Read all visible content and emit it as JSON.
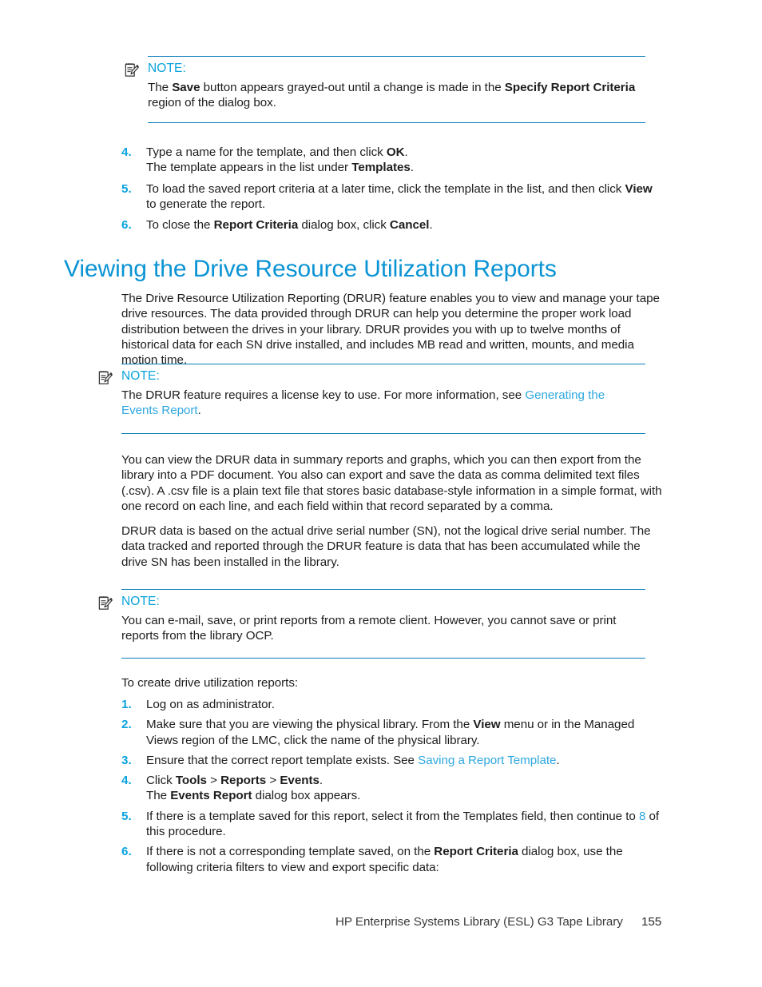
{
  "page": {
    "number": "155",
    "footer_title": "HP Enterprise Systems Library (ESL) G3 Tape Library"
  },
  "colors": {
    "heading_blue": "#0b94d4",
    "note_label_blue": "#0aa3dd",
    "rule_blue": "#0b7fb8",
    "link_blue": "#2fa8e0",
    "body_text": "#1d1d1d"
  },
  "note_1": {
    "icon": "note-pad-pencil-icon",
    "label": "NOTE:",
    "text_parts": [
      {
        "t": "The ",
        "b": false
      },
      {
        "t": "Save",
        "b": true
      },
      {
        "t": " button appears grayed-out until a change is made in the ",
        "b": false
      },
      {
        "t": "Specify Report Criteria",
        "b": true
      },
      {
        "t": " region of the dialog box.",
        "b": false
      }
    ]
  },
  "steps_top": {
    "items": [
      {
        "marker": "4.",
        "lines": [
          [
            {
              "t": "Type a name for the template, and then click ",
              "b": false
            },
            {
              "t": "OK",
              "b": true
            },
            {
              "t": ".",
              "b": false
            }
          ],
          [
            {
              "t": "The template appears in the list under ",
              "b": false
            },
            {
              "t": "Templates",
              "b": true
            },
            {
              "t": ".",
              "b": false
            }
          ]
        ]
      },
      {
        "marker": "5.",
        "lines": [
          [
            {
              "t": "To load the saved report criteria at a later time, click the template in the list, and then click ",
              "b": false
            },
            {
              "t": "View",
              "b": true
            },
            {
              "t": " to generate the report.",
              "b": false
            }
          ]
        ]
      },
      {
        "marker": "6.",
        "lines": [
          [
            {
              "t": "To close the ",
              "b": false
            },
            {
              "t": "Report Criteria",
              "b": true
            },
            {
              "t": " dialog box, click ",
              "b": false
            },
            {
              "t": "Cancel",
              "b": true
            },
            {
              "t": ".",
              "b": false
            }
          ]
        ]
      }
    ]
  },
  "heading": {
    "text": "Viewing the Drive Resource Utilization Reports"
  },
  "intro_paragraph": {
    "text": "The Drive Resource Utilization Reporting (DRUR) feature enables you to view and manage your tape drive resources. The data provided through DRUR can help you determine the proper work load distribution between the drives in your library. DRUR provides you with up to twelve months of historical data for each SN drive installed, and includes MB read and written, mounts, and media motion time."
  },
  "note_2": {
    "icon": "note-pad-pencil-icon",
    "label": "NOTE:",
    "text_parts": [
      {
        "t": "The DRUR feature requires a license key to use. For more information, see ",
        "b": false,
        "link": false
      },
      {
        "t": "Generating the Events Report",
        "b": false,
        "link": true
      },
      {
        "t": ".",
        "b": false,
        "link": false
      }
    ]
  },
  "body_paragraphs": [
    {
      "text": "You can view the DRUR data in summary reports and graphs, which you can then export from the library into a PDF document. You also can export and save the data as comma delimited text files (.csv). A .csv file is a plain text file that stores basic database-style information in a simple format, with one record on each line, and each field within that record separated by a comma."
    },
    {
      "text": "DRUR data is based on the actual drive serial number (SN), not the logical drive serial number. The data tracked and reported through the DRUR feature is data that has been accumulated while the drive SN has been installed in the library."
    }
  ],
  "note_3": {
    "icon": "note-pad-pencil-icon",
    "label": "NOTE:",
    "text_parts": [
      {
        "t": "You can e-mail, save, or print reports from a remote client. However, you cannot save or print reports from the library OCP.",
        "b": false
      }
    ]
  },
  "lead_in": {
    "text": "To create drive utilization reports:"
  },
  "steps_bottom": {
    "items": [
      {
        "marker": "1.",
        "lines": [
          [
            {
              "t": "Log on as administrator.",
              "b": false
            }
          ]
        ]
      },
      {
        "marker": "2.",
        "lines": [
          [
            {
              "t": "Make sure that you are viewing the physical library. From the ",
              "b": false
            },
            {
              "t": "View",
              "b": true
            },
            {
              "t": " menu or in the Managed Views region of the LMC, click the name of the physical library.",
              "b": false
            }
          ]
        ]
      },
      {
        "marker": "3.",
        "lines": [
          [
            {
              "t": "Ensure that the correct report template exists. See ",
              "b": false
            },
            {
              "t": "Saving a Report Template",
              "b": false,
              "link": true
            },
            {
              "t": ".",
              "b": false
            }
          ]
        ]
      },
      {
        "marker": "4.",
        "lines": [
          [
            {
              "t": "Click ",
              "b": false
            },
            {
              "t": "Tools",
              "b": true
            },
            {
              "t": " > ",
              "b": false
            },
            {
              "t": "Reports",
              "b": true
            },
            {
              "t": " > ",
              "b": false
            },
            {
              "t": "Events",
              "b": true
            },
            {
              "t": ".",
              "b": false
            }
          ],
          [
            {
              "t": "The ",
              "b": false
            },
            {
              "t": "Events Report",
              "b": true
            },
            {
              "t": " dialog box appears.",
              "b": false
            }
          ]
        ]
      },
      {
        "marker": "5.",
        "lines": [
          [
            {
              "t": "If there is a template saved for this report, select it from the Templates field, then continue to ",
              "b": false
            },
            {
              "t": "8",
              "b": false,
              "link": true
            },
            {
              "t": " of this procedure.",
              "b": false
            }
          ]
        ]
      },
      {
        "marker": "6.",
        "lines": [
          [
            {
              "t": "If there is not a corresponding template saved, on the ",
              "b": false
            },
            {
              "t": "Report Criteria",
              "b": true
            },
            {
              "t": " dialog box, use the following criteria filters to view and export specific data:",
              "b": false
            }
          ]
        ]
      }
    ]
  }
}
